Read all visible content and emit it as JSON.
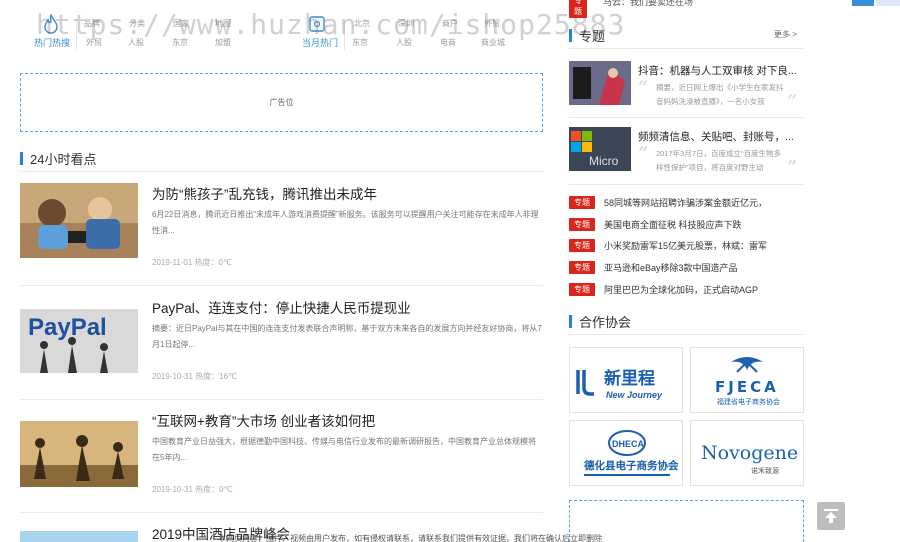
{
  "watermark": "https://www.huzhan.com/ishop25883",
  "hot_strip": {
    "groups": [
      {
        "title": "热门热搜",
        "links": [
          [
            "品牌",
            "外贸"
          ],
          [
            "分类",
            "人股"
          ],
          [
            "国家",
            "东京"
          ],
          [
            "地图",
            "加盟"
          ]
        ]
      },
      {
        "title": "当月热门",
        "links": [
          [
            "北京",
            "东京"
          ],
          [
            "深圳",
            "人股"
          ],
          [
            "商户",
            "电商"
          ],
          [
            "外贸",
            "商业城"
          ]
        ]
      }
    ]
  },
  "ad": {
    "label": "广告位"
  },
  "section_24h": {
    "title": "24小时看点"
  },
  "articles": [
    {
      "title": "为防“熊孩子”乱充钱，腾讯推出未成年",
      "desc": "6月22日消息，腾讯近日推出“未成年人游戏消费提醒”新服务。该服务可以提醒用户关注可能存在未成年人非理性消...",
      "meta": "2019-11-01 热度：0℃"
    },
    {
      "title": "PayPal、连连支付：停止快捷人民币提现业",
      "desc": "摘要：近日PayPal与其在中国的连连支付发表联合声明称，基于双方未来各自的发展方向并经友好协商，将从7月1日起停...",
      "meta": "2019-10-31 热度：16℃"
    },
    {
      "title": "“互联网+教育”大市场 创业者该如何把",
      "desc": "中国教育产业日益强大，根据德勤中国科技、传媒与电信行业发布的最新调研报告，中国教育产业总体规模将在5年内...",
      "meta": "2019-10-31 热度：0℃"
    },
    {
      "title": "2019中国酒店品牌峰会",
      "desc": "",
      "meta": ""
    }
  ],
  "right": {
    "top_tag": "专题",
    "top_text": "马云：我们要卖还在场",
    "topics_section": {
      "title": "专题",
      "more": "更多 >"
    },
    "topics": [
      {
        "title": "抖音：机器与人工双审核 对下良...",
        "desc": "摘要，近日网上爆出《小学生在家发抖音妈妈洗澡被直播》，一名小女孩"
      },
      {
        "title": "频频清信息、关贴吧、封账号，...",
        "desc": "2017年3月7日，百度成立“百度生物多样性保护”项目，将百度对野生动"
      }
    ],
    "topic_list": [
      {
        "tag": "专题",
        "text": "58同城等网站招聘诈骗涉案金额近亿元，"
      },
      {
        "tag": "专题",
        "text": "美国电商全面征税 科技股应声下跌"
      },
      {
        "tag": "专题",
        "text": "小米奖励雷军15亿美元股票，林斌：雷军"
      },
      {
        "tag": "专题",
        "text": "亚马逊和eBay移除3款中国造产品"
      },
      {
        "tag": "专题",
        "text": "阿里巴巴为全球化加码，正式启动AGP"
      }
    ],
    "partners_section": {
      "title": "合作协会"
    },
    "partners": [
      {
        "name": "新里程",
        "sub": "New Journey",
        "color": "#1a5fb0"
      },
      {
        "name": "FJECA",
        "sub": "福建省电子商务协会",
        "color": "#1a5fb0"
      },
      {
        "name": "DHECA",
        "sub": "德化县电子商务协会",
        "color": "#1a5fb0"
      },
      {
        "name": "Novogene",
        "sub": "诺禾致源",
        "color": "#1a5fb0"
      }
    ]
  },
  "footer": {
    "text": "本网页内容、图片、视频由用户发布，如有侵权请联系，请联系我们提供有效证据，我们将在确认后立即删除"
  }
}
